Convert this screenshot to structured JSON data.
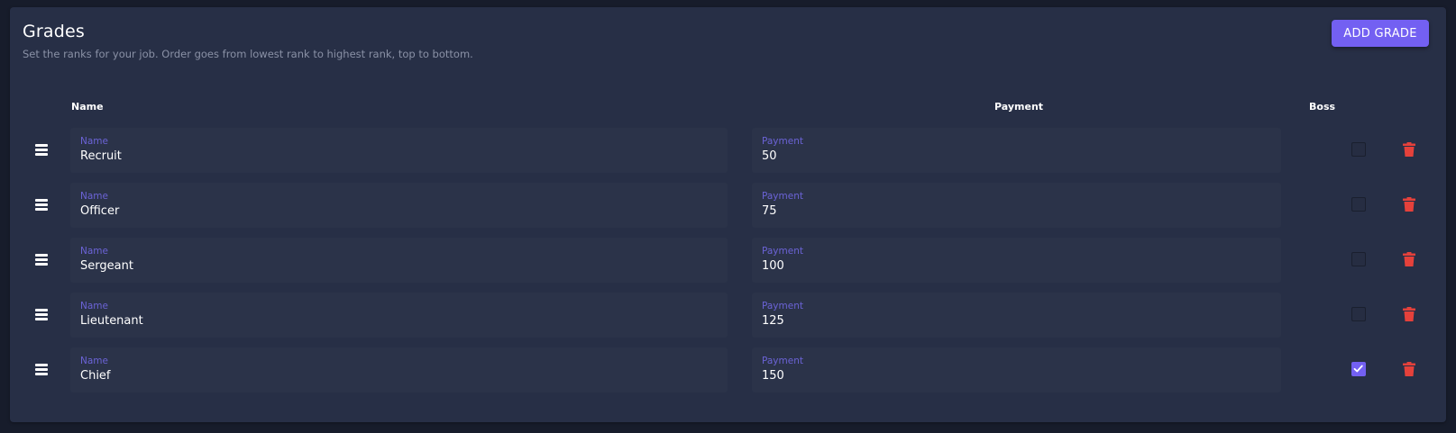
{
  "header": {
    "title": "Grades",
    "subtitle": "Set the ranks for your job. Order goes from lowest rank to highest rank, top to bottom.",
    "add_button_label": "ADD GRADE"
  },
  "table": {
    "columns": {
      "name": "Name",
      "payment": "Payment",
      "boss": "Boss"
    },
    "field_labels": {
      "name": "Name",
      "payment": "Payment"
    },
    "rows": [
      {
        "name": "Recruit",
        "payment": "50",
        "boss": false
      },
      {
        "name": "Officer",
        "payment": "75",
        "boss": false
      },
      {
        "name": "Sergeant",
        "payment": "100",
        "boss": false
      },
      {
        "name": "Lieutenant",
        "payment": "125",
        "boss": false
      },
      {
        "name": "Chief",
        "payment": "150",
        "boss": true
      }
    ]
  },
  "icons": {
    "drag": "drag-handle-icon",
    "delete": "trash-icon",
    "check": "checkmark-icon"
  },
  "colors": {
    "background": "#171c2b",
    "panel": "#272f46",
    "field": "#2b3349",
    "accent": "#7360f2",
    "label": "#6b63d6",
    "delete": "#e5413b",
    "subtitle": "#8a91a6"
  }
}
